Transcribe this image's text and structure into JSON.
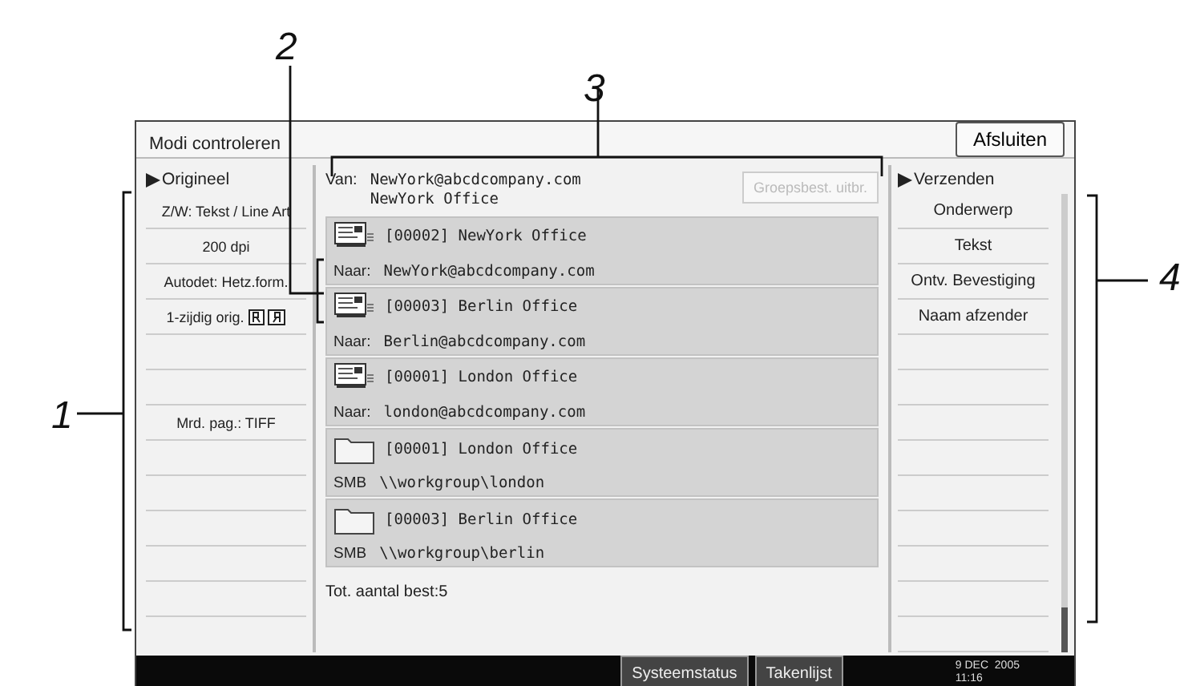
{
  "callouts": [
    {
      "label": "1"
    },
    {
      "label": "2"
    },
    {
      "label": "3"
    },
    {
      "label": "4"
    }
  ],
  "screen": {
    "title": "Modi controleren",
    "close_button": "Afsluiten",
    "left_panel": {
      "heading": "Origineel",
      "rows": [
        {
          "text": "Z/W: Tekst / Line Art"
        },
        {
          "text": "200 dpi"
        },
        {
          "text": "Autodet: Hetz.form."
        },
        {
          "text": "1-zijdig orig.",
          "duplex_icon": true
        },
        {
          "text": ""
        },
        {
          "text": ""
        },
        {
          "text": "Mrd. pag.: TIFF"
        },
        {
          "text": ""
        },
        {
          "text": ""
        },
        {
          "text": ""
        },
        {
          "text": ""
        },
        {
          "text": ""
        }
      ]
    },
    "sender": {
      "label": "Van:",
      "address": "NewYork@abcdcompany.com",
      "name": "NewYork Office",
      "button": {
        "label": "Groepsbest. uitbr.",
        "disabled": true
      }
    },
    "destinations": [
      {
        "kind": "email",
        "title": "[00002] NewYork Office",
        "prefix": "Naar:",
        "address": "NewYork@abcdcompany.com"
      },
      {
        "kind": "email",
        "title": "[00003] Berlin Office",
        "prefix": "Naar:",
        "address": "Berlin@abcdcompany.com"
      },
      {
        "kind": "email",
        "title": "[00001] London Office",
        "prefix": "Naar:",
        "address": "london@abcdcompany.com"
      },
      {
        "kind": "folder",
        "title": "[00001] London Office",
        "prefix": "SMB",
        "address": "\\\\workgroup\\london"
      },
      {
        "kind": "folder",
        "title": "[00003] Berlin Office",
        "prefix": "SMB",
        "address": "\\\\workgroup\\berlin"
      }
    ],
    "total": "Tot. aantal best:5",
    "right_panel": {
      "heading": "Verzenden",
      "rows": [
        {
          "text": "Onderwerp"
        },
        {
          "text": "Tekst"
        },
        {
          "text": "Ontv. Bevestiging"
        },
        {
          "text": "Naam afzender"
        },
        {
          "text": ""
        },
        {
          "text": ""
        },
        {
          "text": ""
        },
        {
          "text": ""
        },
        {
          "text": ""
        },
        {
          "text": ""
        },
        {
          "text": ""
        },
        {
          "text": ""
        },
        {
          "text": ""
        }
      ]
    },
    "status_bar": {
      "buttons": [
        "Systeemstatus",
        "Takenlijst"
      ],
      "date": "9 DEC  2005",
      "time": "11:16"
    }
  }
}
